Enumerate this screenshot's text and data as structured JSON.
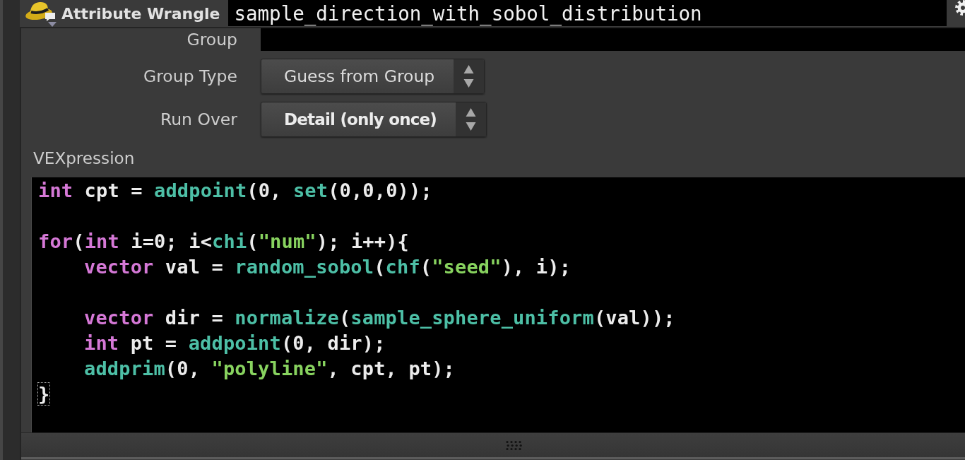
{
  "node": {
    "type_label": "Attribute Wrangle",
    "name": "sample_direction_with_sobol_distribution"
  },
  "parameters": [
    {
      "kind": "field",
      "label": "Group"
    },
    {
      "kind": "menu",
      "label": "Group Type",
      "value": "Guess from Group",
      "non_default": false
    },
    {
      "kind": "menu",
      "label": "Run Over",
      "value": "Detail (only once)",
      "non_default": true
    }
  ],
  "vexpression": {
    "label": "VEXpression",
    "lines": [
      {
        "kind": "code",
        "tokens": [
          {
            "kind": "keyword",
            "text": "int"
          },
          {
            "kind": "plain",
            "text": " cpt = "
          },
          {
            "kind": "function",
            "text": "addpoint"
          },
          {
            "kind": "plain",
            "text": "(0, "
          },
          {
            "kind": "function",
            "text": "set"
          },
          {
            "kind": "plain",
            "text": "(0,0,0));"
          }
        ]
      },
      {
        "kind": "blank"
      },
      {
        "kind": "code",
        "tokens": [
          {
            "kind": "keyword",
            "text": "for"
          },
          {
            "kind": "plain",
            "text": "("
          },
          {
            "kind": "keyword",
            "text": "int"
          },
          {
            "kind": "plain",
            "text": " i=0; i<"
          },
          {
            "kind": "function",
            "text": "chi"
          },
          {
            "kind": "plain",
            "text": "("
          },
          {
            "kind": "string",
            "text": "\"num\""
          },
          {
            "kind": "plain",
            "text": "); i++){"
          }
        ],
        "children": [
          {
            "kind": "code",
            "tokens": [
              {
                "kind": "keyword",
                "text": "vector"
              },
              {
                "kind": "plain",
                "text": " val = "
              },
              {
                "kind": "function",
                "text": "random_sobol"
              },
              {
                "kind": "plain",
                "text": "("
              },
              {
                "kind": "function",
                "text": "chf"
              },
              {
                "kind": "plain",
                "text": "("
              },
              {
                "kind": "string",
                "text": "\"seed\""
              },
              {
                "kind": "plain",
                "text": "), i);"
              }
            ]
          },
          {
            "kind": "blank"
          },
          {
            "kind": "code",
            "tokens": [
              {
                "kind": "keyword",
                "text": "vector"
              },
              {
                "kind": "plain",
                "text": " dir = "
              },
              {
                "kind": "function",
                "text": "normalize"
              },
              {
                "kind": "plain",
                "text": "("
              },
              {
                "kind": "function",
                "text": "sample_sphere_uniform"
              },
              {
                "kind": "plain",
                "text": "(val));"
              }
            ]
          },
          {
            "kind": "code",
            "tokens": [
              {
                "kind": "keyword",
                "text": "int"
              },
              {
                "kind": "plain",
                "text": " pt = "
              },
              {
                "kind": "function",
                "text": "addpoint"
              },
              {
                "kind": "plain",
                "text": "(0, dir);"
              }
            ]
          },
          {
            "kind": "code",
            "tokens": [
              {
                "kind": "function",
                "text": "addprim"
              },
              {
                "kind": "plain",
                "text": "(0, "
              },
              {
                "kind": "string",
                "text": "\"polyline\""
              },
              {
                "kind": "plain",
                "text": ", cpt, pt);"
              }
            ]
          }
        ]
      },
      {
        "kind": "code",
        "tokens": [
          {
            "kind": "matched_bracket",
            "text": "}"
          }
        ]
      }
    ]
  }
}
